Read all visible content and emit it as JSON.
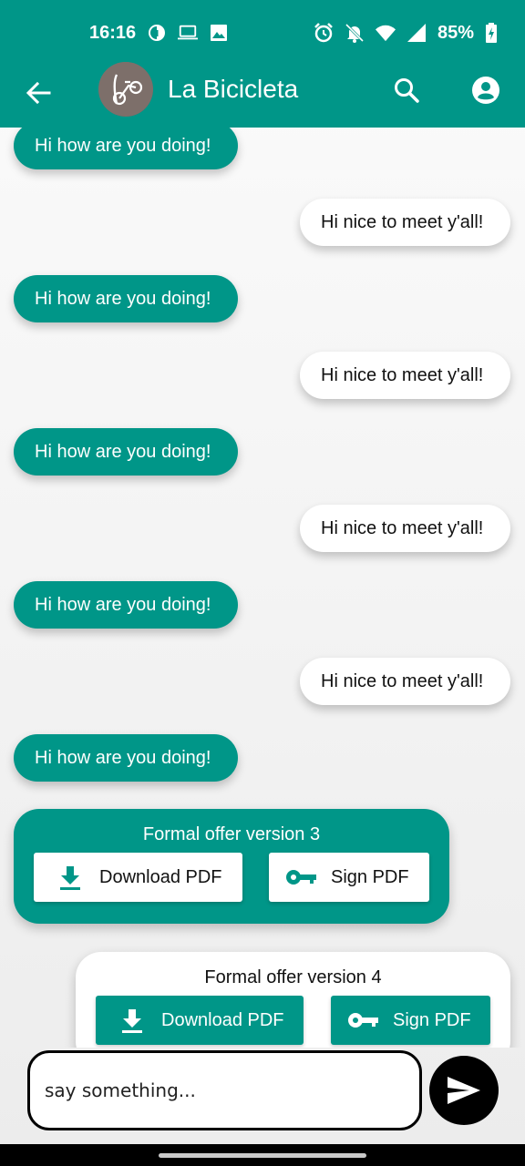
{
  "status_bar": {
    "time": "16:16",
    "battery": "85%",
    "left_icons": [
      "data-saver-icon",
      "laptop-icon",
      "image-icon"
    ],
    "right_icons": [
      "alarm-icon",
      "bell-off-icon",
      "wifi-icon",
      "signal-icon",
      "battery-charging-icon"
    ]
  },
  "app_bar": {
    "title": "La Bicicleta",
    "avatar": "bicycle-logo",
    "actions": [
      "search-icon",
      "account-icon"
    ],
    "background": "#009688"
  },
  "messages": [
    {
      "side": "received",
      "text": "Hi how are you doing!"
    },
    {
      "side": "sent",
      "text": "Hi nice to meet y'all!"
    },
    {
      "side": "received",
      "text": "Hi how are you doing!"
    },
    {
      "side": "sent",
      "text": "Hi nice to meet y'all!"
    },
    {
      "side": "received",
      "text": "Hi how are you doing!"
    },
    {
      "side": "sent",
      "text": "Hi nice to meet y'all!"
    },
    {
      "side": "received",
      "text": "Hi how are you doing!"
    },
    {
      "side": "sent",
      "text": "Hi nice to meet y'all!"
    },
    {
      "side": "received",
      "text": "Hi how are you doing!"
    }
  ],
  "offers": [
    {
      "side": "received",
      "title": "Formal offer version 3",
      "download_label": "Download PDF",
      "sign_label": "Sign PDF"
    },
    {
      "side": "sent",
      "title": "Formal offer version 4",
      "download_label": "Download PDF",
      "sign_label": "Sign PDF"
    }
  ],
  "composer": {
    "placeholder": "say something...",
    "send_icon": "send-icon"
  },
  "colors": {
    "accent": "#009688",
    "sent_bubble": "#ffffff",
    "composer_border": "#000000"
  }
}
